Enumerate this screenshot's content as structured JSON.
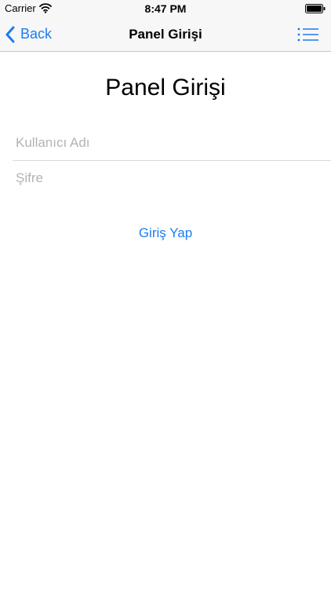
{
  "status_bar": {
    "carrier": "Carrier",
    "time": "8:47 PM"
  },
  "nav": {
    "back_label": "Back",
    "title": "Panel Girişi",
    "accent_color": "#1a7cf3"
  },
  "main": {
    "title": "Panel Girişi",
    "username_placeholder": "Kullanıcı Adı",
    "username_value": "",
    "password_placeholder": "Şifre",
    "password_value": "",
    "login_label": "Giriş Yap"
  },
  "icons": {
    "wifi": "wifi-icon",
    "battery": "battery-icon",
    "back": "chevron-left-icon",
    "menu": "list-icon"
  }
}
